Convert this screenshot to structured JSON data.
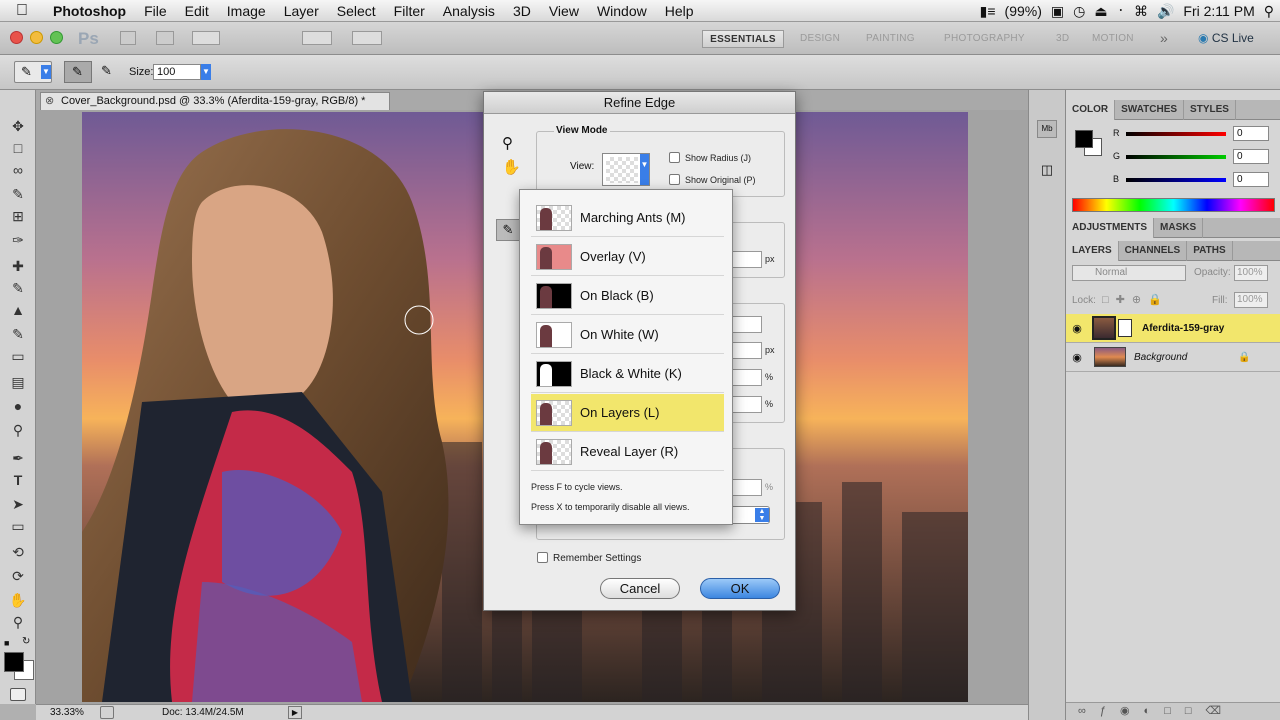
{
  "menubar": {
    "app_name": "Photoshop",
    "items": [
      "File",
      "Edit",
      "Image",
      "Layer",
      "Select",
      "Filter",
      "Analysis",
      "3D",
      "View",
      "Window",
      "Help"
    ],
    "battery": "(99%)",
    "clock": "Fri 2:11 PM"
  },
  "appbar": {
    "logo": "Ps",
    "workspaces": [
      "ESSENTIALS",
      "DESIGN",
      "PAINTING",
      "PHOTOGRAPHY",
      "3D",
      "MOTION"
    ],
    "cs_live": "CS Live"
  },
  "options": {
    "size_label": "Size:",
    "size_value": "100"
  },
  "document": {
    "tab_title": "Cover_Background.psd @ 33.3% (Aferdita-159-gray, RGB/8) *",
    "zoom": "33.33%",
    "doc_info": "Doc: 13.4M/24.5M"
  },
  "panels": {
    "color_tabs": [
      "COLOR",
      "SWATCHES",
      "STYLES"
    ],
    "color": {
      "r_label": "R",
      "g_label": "G",
      "b_label": "B",
      "r": "0",
      "g": "0",
      "b": "0"
    },
    "adj_tabs": [
      "ADJUSTMENTS",
      "MASKS"
    ],
    "layer_tabs": [
      "LAYERS",
      "CHANNELS",
      "PATHS"
    ],
    "blend_mode": "Normal",
    "opacity_label": "Opacity:",
    "opacity": "100%",
    "lock_label": "Lock:",
    "fill_label": "Fill:",
    "fill": "100%",
    "layers": [
      {
        "name": "Aferdita-159-gray",
        "selected": true
      },
      {
        "name": "Background",
        "selected": false
      }
    ]
  },
  "dialog": {
    "title": "Refine Edge",
    "view_mode_label": "View Mode",
    "view_label": "View:",
    "show_radius": "Show Radius (J)",
    "show_original": "Show Original (P)",
    "px1": "px",
    "px2": "px",
    "pct1": "%",
    "pct2": "%",
    "pct3": "%",
    "remember": "Remember Settings",
    "cancel": "Cancel",
    "ok": "OK"
  },
  "view_menu": {
    "items": [
      {
        "label": "Marching Ants (M)",
        "thumb": "ants"
      },
      {
        "label": "Overlay (V)",
        "thumb": "overlay"
      },
      {
        "label": "On Black (B)",
        "thumb": "black"
      },
      {
        "label": "On White (W)",
        "thumb": "white"
      },
      {
        "label": "Black & White (K)",
        "thumb": "bw"
      },
      {
        "label": "On Layers (L)",
        "thumb": "layers"
      },
      {
        "label": "Reveal Layer (R)",
        "thumb": "reveal"
      }
    ],
    "selected_index": 5,
    "hint1": "Press F to cycle views.",
    "hint2": "Press X to temporarily disable all views."
  },
  "colors": {
    "accent": "#f2e66c",
    "ok_button": "#5a9be8"
  }
}
